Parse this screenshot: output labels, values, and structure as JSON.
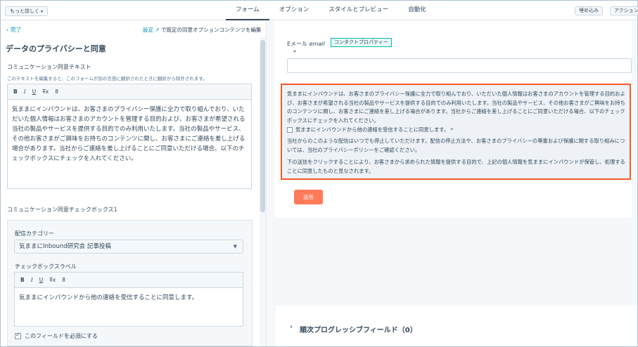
{
  "topbar": {
    "more_button": "もっと詳しく",
    "tabs": [
      {
        "label": "フォーム",
        "active": true
      },
      {
        "label": "オプション",
        "active": false
      },
      {
        "label": "スタイルとプレビュー",
        "active": false
      },
      {
        "label": "自動化",
        "active": false
      }
    ],
    "embed_button": "埋め込み",
    "actions_button": "アクション"
  },
  "left_panel": {
    "done_label": "完了",
    "settings_link": "設定",
    "settings_suffix": "で既定の同意オプションコンテンツを編集",
    "section_title": "データのプライバシーと同意",
    "consent_text_label": "コミュニケーション同意テキスト",
    "consent_text_help": "このテキストを編集すると、このフォームが別の言語に翻訳されたときに翻訳から除外されます。",
    "toolbar": {
      "bold": "B",
      "italic": "I",
      "underline": "U",
      "clear": "T̶x",
      "link": "8"
    },
    "consent_text_body": "気ままにインバウンドは、お客さまのプライバシー保護に全力で取り組んでおり、いただいた個人情報はお客さまのアカウントを管理する目的および、お客さまが希望される当社の製品やサービスを提供する目的でのみ利用いたします。当社の製品やサービス、その他お客さまがご興味をお持ちのコンテンツに関し、お客さまにご連絡を差し上げる場合があります。当社からご連絡を差し上げることにご同意いただける場合、以下のチェックボックスにチェックを入れてください。",
    "checkbox_section_label": "コミュニケーション同意チェックボックス1",
    "delivery_category_label": "配信カテゴリー",
    "delivery_category_value": "気ままにInbound研究会 記事投稿",
    "checkbox_label_label": "チェックボックスラベル",
    "checkbox_label_body": "気ままにインバウンドから他の連絡を受信することに同意します。",
    "required_label": "このフィールドを必須にする"
  },
  "preview": {
    "email_label": "Eメール",
    "email_field": "email",
    "contact_badge": "コンタクトプロパティー",
    "required_mark": "*",
    "consent_paragraph": "気ままにインバウンドは、お客さまのプライバシー保護に全力で取り組んでおり、いただいた個人情報はお客さまのアカウントを管理する目的および、お客さまが希望される当社の製品やサービスを提供する目的でのみ利用いたします。当社の製品やサービス、その他お客さまがご興味をお持ちのコンテンツに関し、お客さまにご連絡を差し上げる場合があります。当社からご連絡を差し上げることにご同意いただける場合、以下のチェックボックスにチェックを入れてください。",
    "consent_checkbox_label": "気ままにインバウンドから他の連絡を受信することに同意します。 *",
    "unsubscribe_paragraph": "当社からのこのような配信はいつでも停止していただけます。配信の停止方法や、お客さまのプライバシーの尊重および保護に関する取り組みについては、当社のプライバシーポリシーをご確認ください。",
    "submit_notice": "下の送信をクリックすることにより、お客さまから求められた情報を提供する目的で、上記の個人情報を気ままにインバウンドが保管し、処理することに同意したものと見なされます。",
    "submit_label": "送信",
    "progressive_fields": "順次プログレッシブフィールド（0）"
  },
  "colors": {
    "accent": "#0091ae",
    "highlight_border": "#f05a28",
    "submit": "#ff7a59"
  }
}
